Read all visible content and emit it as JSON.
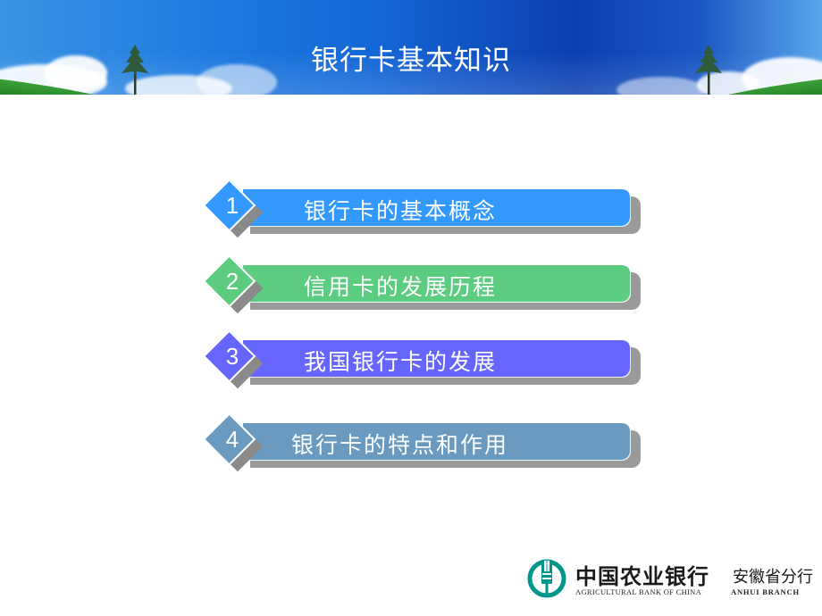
{
  "header": {
    "title": "银行卡基本知识"
  },
  "menu": {
    "items": [
      {
        "number": "1",
        "label": "银行卡的基本概念",
        "color": "#3399ff"
      },
      {
        "number": "2",
        "label": "信用卡的发展历程",
        "color": "#5ccc80"
      },
      {
        "number": "3",
        "label": "我国银行卡的发展",
        "color": "#6666ff"
      },
      {
        "number": "4",
        "label": "银行卡的特点和作用",
        "color": "#6a9ac0"
      }
    ]
  },
  "footer": {
    "bank_name_cn": "中国农业银行",
    "branch_cn": "安徽省分行",
    "bank_name_en": "AGRICULTURAL BANK OF CHINA",
    "branch_en": "ANHUI  BRANCH",
    "logo_color": "#00968c",
    "logo_icon": "abc-bank-logo-icon"
  }
}
